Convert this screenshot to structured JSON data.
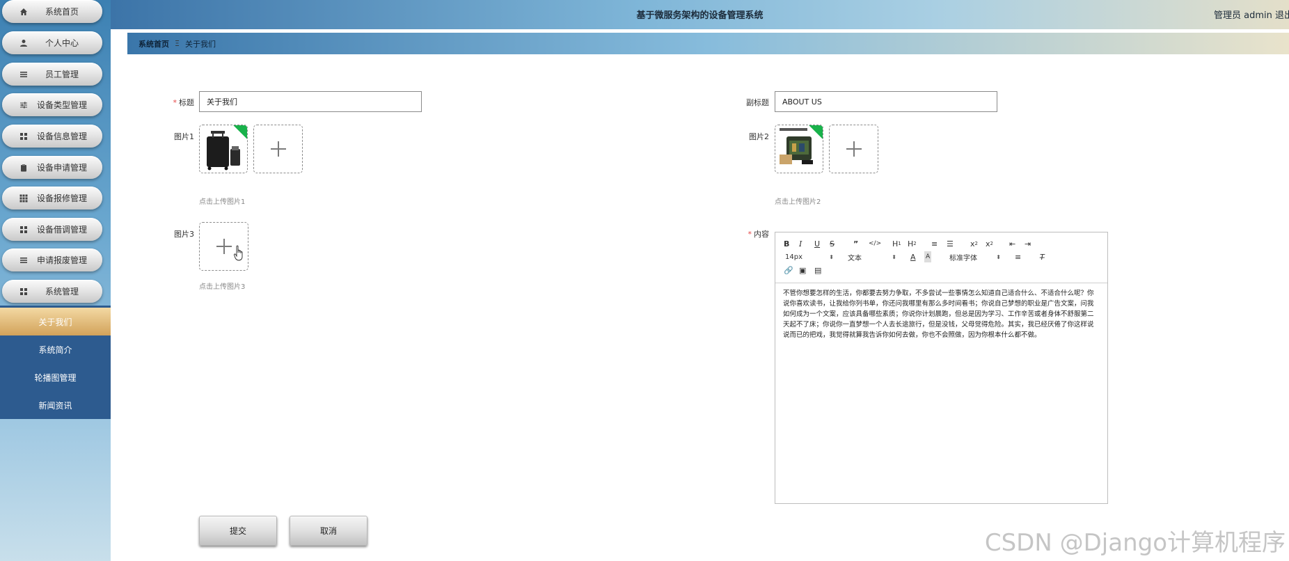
{
  "header": {
    "title": "基于微服务架构的设备管理系统",
    "user_text": "管理员 admin  退出"
  },
  "breadcrumb": {
    "home": "系统首页",
    "current": "关于我们"
  },
  "sidebar": {
    "items": [
      {
        "label": "系统首页",
        "icon": "home-icon"
      },
      {
        "label": "个人中心",
        "icon": "user-icon"
      },
      {
        "label": "员工管理",
        "icon": "list-icon"
      },
      {
        "label": "设备类型管理",
        "icon": "sliders-icon"
      },
      {
        "label": "设备信息管理",
        "icon": "grid-icon"
      },
      {
        "label": "设备申请管理",
        "icon": "clipboard-icon"
      },
      {
        "label": "设备报修管理",
        "icon": "apps-icon"
      },
      {
        "label": "设备借调管理",
        "icon": "grid-icon"
      },
      {
        "label": "申请报废管理",
        "icon": "list-icon"
      },
      {
        "label": "系统管理",
        "icon": "grid-icon"
      }
    ],
    "sub_items": [
      {
        "label": "关于我们",
        "active": true
      },
      {
        "label": "系统简介",
        "active": false
      },
      {
        "label": "轮播图管理",
        "active": false
      },
      {
        "label": "新闻资讯",
        "active": false
      }
    ]
  },
  "form": {
    "title_label": "标题",
    "title_value": "关于我们",
    "subtitle_label": "副标题",
    "subtitle_value": "ABOUT US",
    "pic1_label": "图片1",
    "pic1_hint": "点击上传图片1",
    "pic2_label": "图片2",
    "pic2_hint": "点击上传图片2",
    "pic3_label": "图片3",
    "pic3_hint": "点击上传图片3",
    "content_label": "内容"
  },
  "editor": {
    "font_size": "14px",
    "header_select": "文本",
    "font_family": "标准字体",
    "content": "不管你想要怎样的生活，你都要去努力争取，不多尝试一些事情怎么知道自己适合什么、不适合什么呢？你说你喜欢读书，让我给你列书单，你还问我哪里有那么多时间看书；你说自己梦想的职业是广告文案，问我如何成为一个文案，应该具备哪些素质；你说你计划晨跑，但总是因为学习、工作辛苦或者身体不舒服第二天起不了床；你说你一直梦想一个人去长途旅行，但是没钱，父母觉得危险。其实，我已经厌倦了你这样说说而已的把戏，我觉得就算我告诉你如何去做，你也不会照做，因为你根本什么都不做。"
  },
  "buttons": {
    "submit": "提交",
    "cancel": "取消"
  },
  "watermark": "CSDN @Django计算机程序"
}
